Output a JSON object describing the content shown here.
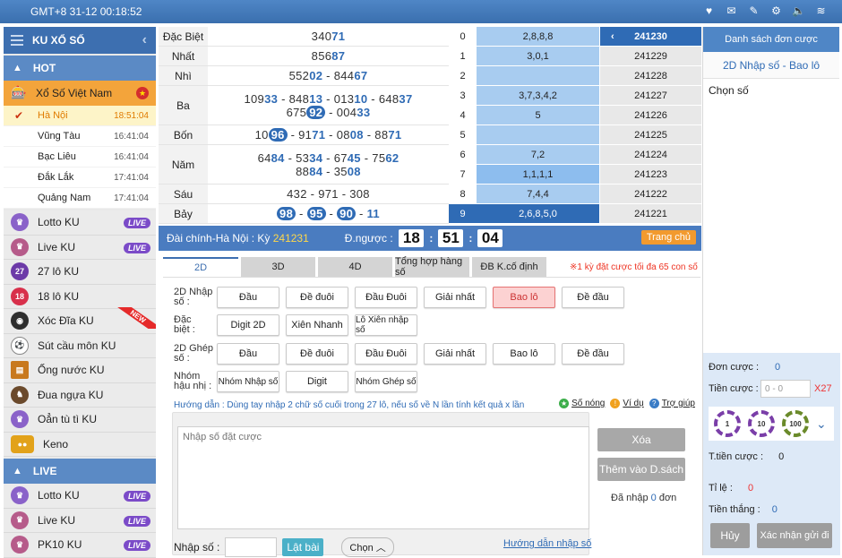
{
  "topbar": {
    "clock": "GMT+8 31-12 00:18:52"
  },
  "sidebar": {
    "title": "KU XỔ SỐ",
    "hot_label": "HOT",
    "xsvn": "Xổ Số Việt Nam",
    "subs": [
      {
        "name": "Hà Nội",
        "time": "18:51:04"
      },
      {
        "name": "Vũng Tàu",
        "time": "16:41:04"
      },
      {
        "name": "Bạc Liêu",
        "time": "16:41:04"
      },
      {
        "name": "Đắk Lắk",
        "time": "17:41:04"
      },
      {
        "name": "Quảng Nam",
        "time": "17:41:04"
      }
    ],
    "items": [
      {
        "label": "Lotto KU",
        "badge": "LIVE"
      },
      {
        "label": "Live KU",
        "badge": "LIVE"
      },
      {
        "label": "27 lô KU",
        "icon": "27"
      },
      {
        "label": "18 lô KU",
        "icon": "18"
      },
      {
        "label": "Xóc Đĩa KU",
        "new": "NEW"
      },
      {
        "label": "Sút cầu môn KU"
      },
      {
        "label": "Ống nước KU"
      },
      {
        "label": "Đua ngựa KU"
      },
      {
        "label": "Oẳn tù tì KU"
      },
      {
        "label": "Keno"
      }
    ],
    "live_label": "LIVE",
    "live_items": [
      {
        "label": "Lotto KU",
        "badge": "LIVE"
      },
      {
        "label": "Live KU",
        "badge": "LIVE"
      },
      {
        "label": "PK10 KU",
        "badge": "LIVE"
      }
    ]
  },
  "results": {
    "db_label": "Đặc Biệt",
    "db_a": "340",
    "db_b": "71",
    "nhat_label": "Nhất",
    "nhat_a": "856",
    "nhat_b": "87",
    "nhi_label": "Nhì",
    "nhi_a1": "552",
    "nhi_b1": "02",
    "nhi_sep": " - ",
    "nhi_a2": "844",
    "nhi_b2": "67",
    "ba_label": "Ba",
    "ba_l1": [
      [
        "109",
        "33"
      ],
      [
        "848",
        "13"
      ],
      [
        "013",
        "10"
      ],
      [
        "648",
        "37"
      ]
    ],
    "ba_l2": [
      [
        "675",
        "92"
      ],
      [
        "004",
        "33"
      ]
    ],
    "bon_label": "Bốn",
    "bon": [
      [
        "10",
        "96"
      ],
      [
        "91",
        "71"
      ],
      [
        "08",
        "08"
      ],
      [
        "88",
        "71"
      ]
    ],
    "nam_label": "Năm",
    "nam_l1": [
      [
        "64",
        "84"
      ],
      [
        "53",
        "34"
      ],
      [
        "67",
        "45"
      ],
      [
        "75",
        "62"
      ]
    ],
    "nam_l2": [
      [
        "88",
        "84"
      ],
      [
        "35",
        "08"
      ]
    ],
    "sau_label": "Sáu",
    "sau": [
      "432",
      "971",
      "308"
    ],
    "bay_label": "Bảy",
    "bay": [
      "98",
      "95",
      "90",
      "11"
    ]
  },
  "stats": [
    {
      "n": "0",
      "v": "2,8,8,8"
    },
    {
      "n": "1",
      "v": "3,0,1"
    },
    {
      "n": "2",
      "v": ""
    },
    {
      "n": "3",
      "v": "3,7,3,4,2"
    },
    {
      "n": "4",
      "v": "5"
    },
    {
      "n": "5",
      "v": ""
    },
    {
      "n": "6",
      "v": "7,2"
    },
    {
      "n": "7",
      "v": "1,1,1,1"
    },
    {
      "n": "8",
      "v": "7,4,4"
    },
    {
      "n": "9",
      "v": "2,6,8,5,0"
    }
  ],
  "periods": [
    "241230",
    "241229",
    "241228",
    "241227",
    "241226",
    "241225",
    "241224",
    "241223",
    "241222",
    "241221"
  ],
  "ctrl": {
    "dc": "Đài chính-Hà Nội : Kỳ",
    "ky": "241231",
    "dn": "Đ.ngược :",
    "h": "18",
    "m": "51",
    "s": "04",
    "home": "Trang chủ"
  },
  "tabs": [
    "2D",
    "3D",
    "4D",
    "Tổng hợp hàng số",
    "ĐB K.cố định"
  ],
  "tabnote": "※1 kỳ đặt cược tối đa 65 con số",
  "bet": {
    "r1_label": "2D Nhập số :",
    "r1": [
      "Đầu",
      "Đề đuôi",
      "Đầu Đuôi",
      "Giải nhất",
      "Bao lô",
      "Đề đầu"
    ],
    "r2_label": "Đặc biệt :",
    "r2": [
      "Digit 2D",
      "Xiên Nhanh",
      "Lô Xiên nhập số"
    ],
    "r3_label": "2D Ghép số :",
    "r3": [
      "Đầu",
      "Đề đuôi",
      "Đầu Đuôi",
      "Giải nhất",
      "Bao lô",
      "Đề đầu"
    ],
    "r4_label": "Nhóm hậu nhị :",
    "r4": [
      "Nhóm Nhập số",
      "Digit",
      "Nhóm Ghép số"
    ],
    "guide": "Hướng dẫn : Dùng tay nhập 2 chữ số cuối trong 27 lô, nếu số về N lần tính kết quả x lần",
    "so_nong": "Số nóng",
    "vi_du": "Ví dụ",
    "tro_giup": "Trợ giúp",
    "placeholder": "Nhập số đặt cược",
    "xoa": "Xóa",
    "them": "Thêm vào D.sách",
    "da_nhap": "Đã nhập",
    "da_nhap_n": "0",
    "don": "đơn",
    "nhap_so": "Nhập số :",
    "lat_bai": "Lật bài",
    "chon": "Chọn",
    "hd_nhap": "Hướng dẫn nhập số"
  },
  "right": {
    "head": "Danh sách đơn cược",
    "sub": "2D Nhập số - Bao lô",
    "chon": "Chọn số",
    "don_cuoc": "Đơn cược :",
    "don_cuoc_v": "0",
    "tien_cuoc": "Tiền cược :",
    "tien_ph": "0 - 0",
    "x27": "X27",
    "chips": [
      "1",
      "10",
      "100"
    ],
    "ttien": "T.tiền cược :",
    "ttien_v": "0",
    "tile": "Tỉ lệ :",
    "tile_v": "0",
    "tthang": "Tiền thắng :",
    "tthang_v": "0",
    "huy": "Hủy",
    "xacnhan": "Xác nhận gửi đi"
  }
}
